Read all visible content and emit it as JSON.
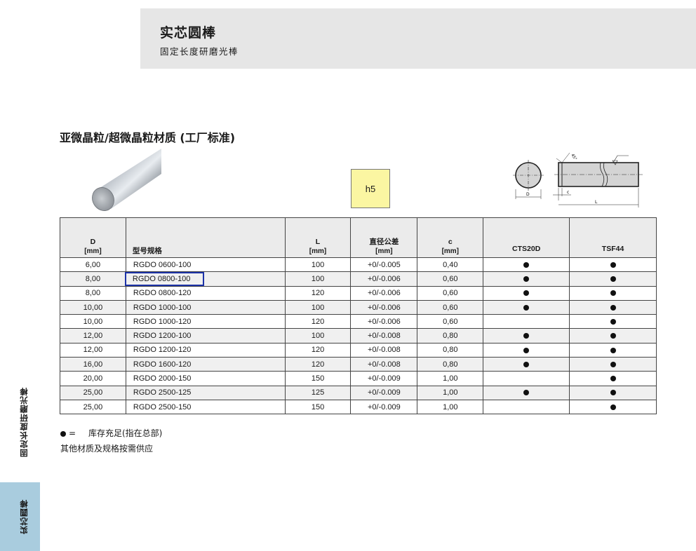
{
  "header": {
    "title": "实芯圆棒",
    "subtitle": "固定长度研磨光棒"
  },
  "section": {
    "title": "亚微晶粒/超微晶粒材质 (工厂标准)"
  },
  "tolerance_box": "h5",
  "drawing": {
    "angle_label": "45°",
    "label_d": "D",
    "label_c": "c",
    "label_l": "L"
  },
  "table": {
    "headers": [
      {
        "top": "D",
        "bottom": "[mm]"
      },
      {
        "top": "",
        "bottom": "型号规格"
      },
      {
        "top": "L",
        "bottom": "[mm]"
      },
      {
        "top": "直径公差",
        "bottom": "[mm]"
      },
      {
        "top": "c",
        "bottom": "[mm]"
      },
      {
        "top": "",
        "bottom": "CTS20D"
      },
      {
        "top": "",
        "bottom": "TSF44"
      }
    ],
    "rows": [
      {
        "d": "6,00",
        "code": "RGDO 0600-100",
        "l": "100",
        "tol": "+0/-0.005",
        "c": "0,40",
        "cts20d": true,
        "tsf44": true
      },
      {
        "d": "8,00",
        "code": "RGDO 0800-100",
        "l": "100",
        "tol": "+0/-0.006",
        "c": "0,60",
        "cts20d": true,
        "tsf44": true
      },
      {
        "d": "8,00",
        "code": "RGDO 0800-120",
        "l": "120",
        "tol": "+0/-0.006",
        "c": "0,60",
        "cts20d": true,
        "tsf44": true
      },
      {
        "d": "10,00",
        "code": "RGDO 1000-100",
        "l": "100",
        "tol": "+0/-0.006",
        "c": "0,60",
        "cts20d": true,
        "tsf44": true
      },
      {
        "d": "10,00",
        "code": "RGDO 1000-120",
        "l": "120",
        "tol": "+0/-0.006",
        "c": "0,60",
        "cts20d": false,
        "tsf44": true
      },
      {
        "d": "12,00",
        "code": "RGDO 1200-100",
        "l": "100",
        "tol": "+0/-0.008",
        "c": "0,80",
        "cts20d": true,
        "tsf44": true
      },
      {
        "d": "12,00",
        "code": "RGDO 1200-120",
        "l": "120",
        "tol": "+0/-0.008",
        "c": "0,80",
        "cts20d": true,
        "tsf44": true
      },
      {
        "d": "16,00",
        "code": "RGDO 1600-120",
        "l": "120",
        "tol": "+0/-0.008",
        "c": "0,80",
        "cts20d": true,
        "tsf44": true
      },
      {
        "d": "20,00",
        "code": "RGDO 2000-150",
        "l": "150",
        "tol": "+0/-0.009",
        "c": "1,00",
        "cts20d": false,
        "tsf44": true
      },
      {
        "d": "25,00",
        "code": "RGDO 2500-125",
        "l": "125",
        "tol": "+0/-0.009",
        "c": "1,00",
        "cts20d": true,
        "tsf44": true
      },
      {
        "d": "25,00",
        "code": "RGDO 2500-150",
        "l": "150",
        "tol": "+0/-0.009",
        "c": "1,00",
        "cts20d": false,
        "tsf44": true
      }
    ],
    "highlighted_row": 1
  },
  "legend": {
    "symbol": "=",
    "text": "库存充足(指在总部)"
  },
  "note": "其他材质及规格按需供应",
  "side": {
    "upper_label": "固定长度研磨光棒",
    "tab_label": "实芯圆棒"
  },
  "colors": {
    "header_band": "#e6e6e6",
    "tolerance_box": "#fbf6a2",
    "highlight_outline": "#1d33a8",
    "side_tab": "#a9ccde"
  },
  "icons": {
    "availability": "filled-circle"
  }
}
